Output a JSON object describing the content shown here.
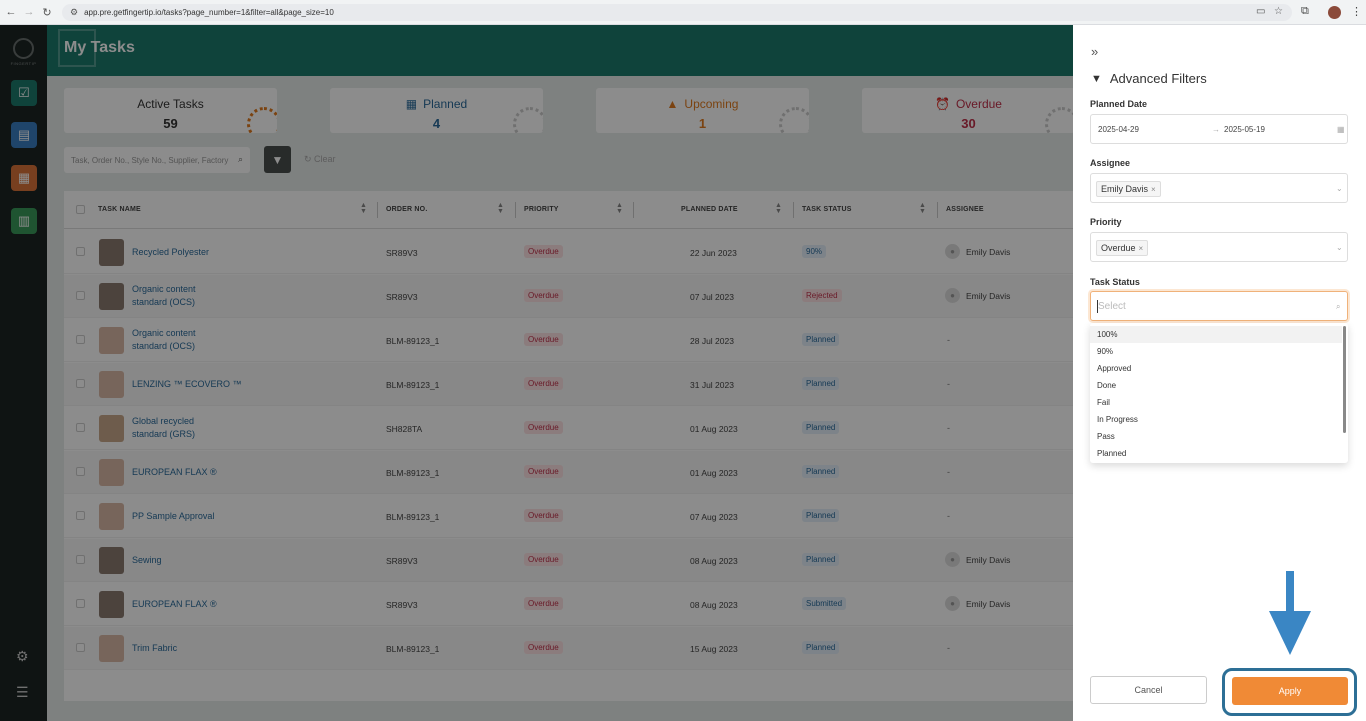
{
  "browser": {
    "url": "app.pre.getfingertip.io/tasks?page_number=1&filter=all&page_size=10"
  },
  "sidebar": {
    "logo_text": "FINGERTIP",
    "items": [
      "tasks-icon",
      "folder-icon",
      "document-search-icon",
      "chart-icon"
    ],
    "bottom": [
      "gear-icon",
      "menu-icon"
    ]
  },
  "header": {
    "title": "My Tasks"
  },
  "cards": [
    {
      "label": "Active Tasks",
      "count": "59"
    },
    {
      "label": "Planned",
      "count": "4"
    },
    {
      "label": "Upcoming",
      "count": "1"
    },
    {
      "label": "Overdue",
      "count": "30"
    }
  ],
  "search": {
    "placeholder": "Task, Order No., Style No., Supplier, Factory",
    "clear_label": "Clear"
  },
  "table": {
    "columns": [
      "TASK NAME",
      "ORDER NO.",
      "PRIORITY",
      "PLANNED DATE",
      "TASK STATUS",
      "ASSIGNEE"
    ],
    "rows": [
      {
        "name": "Recycled Polyester",
        "order": "SR89V3",
        "priority": "Overdue",
        "date": "22 Jun 2023",
        "status": "90%",
        "assignee": "Emily Davis"
      },
      {
        "name": "Organic content standard (OCS)",
        "order": "SR89V3",
        "priority": "Overdue",
        "date": "07 Jul 2023",
        "status": "Rejected",
        "assignee": "Emily Davis"
      },
      {
        "name": "Organic content standard (OCS)",
        "order": "BLM-89123_1",
        "priority": "Overdue",
        "date": "28 Jul 2023",
        "status": "Planned",
        "assignee": "-"
      },
      {
        "name": "LENZING ™ ECOVERO ™",
        "order": "BLM-89123_1",
        "priority": "Overdue",
        "date": "31 Jul 2023",
        "status": "Planned",
        "assignee": "-"
      },
      {
        "name": "Global recycled standard (GRS)",
        "order": "SH828TA",
        "priority": "Overdue",
        "date": "01 Aug 2023",
        "status": "Planned",
        "assignee": "-"
      },
      {
        "name": "EUROPEAN FLAX ®",
        "order": "BLM-89123_1",
        "priority": "Overdue",
        "date": "01 Aug 2023",
        "status": "Planned",
        "assignee": "-"
      },
      {
        "name": "PP Sample Approval",
        "order": "BLM-89123_1",
        "priority": "Overdue",
        "date": "07 Aug 2023",
        "status": "Planned",
        "assignee": "-"
      },
      {
        "name": "Sewing",
        "order": "SR89V3",
        "priority": "Overdue",
        "date": "08 Aug 2023",
        "status": "Planned",
        "assignee": "Emily Davis"
      },
      {
        "name": "EUROPEAN FLAX ®",
        "order": "SR89V3",
        "priority": "Overdue",
        "date": "08 Aug 2023",
        "status": "Submitted",
        "assignee": "Emily Davis"
      },
      {
        "name": "Trim Fabric",
        "order": "BLM-89123_1",
        "priority": "Overdue",
        "date": "15 Aug 2023",
        "status": "Planned",
        "assignee": "-"
      }
    ]
  },
  "filters": {
    "title": "Advanced Filters",
    "planned_date_label": "Planned Date",
    "date_from": "2025-04-29",
    "date_to": "2025-05-19",
    "assignee_label": "Assignee",
    "assignee_tag": "Emily Davis",
    "priority_label": "Priority",
    "priority_tag": "Overdue",
    "status_label": "Task Status",
    "status_placeholder": "Select",
    "status_options": [
      "100%",
      "90%",
      "Approved",
      "Done",
      "Fail",
      "In Progress",
      "Pass",
      "Planned"
    ],
    "cancel_label": "Cancel",
    "apply_label": "Apply"
  },
  "colors": {
    "accent": "#1d7a6c",
    "apply": "#f08a36",
    "highlight": "#2d6f96",
    "overdue": "#c0304a",
    "upcoming": "#e07b1f",
    "planned": "#2a6b9b"
  }
}
